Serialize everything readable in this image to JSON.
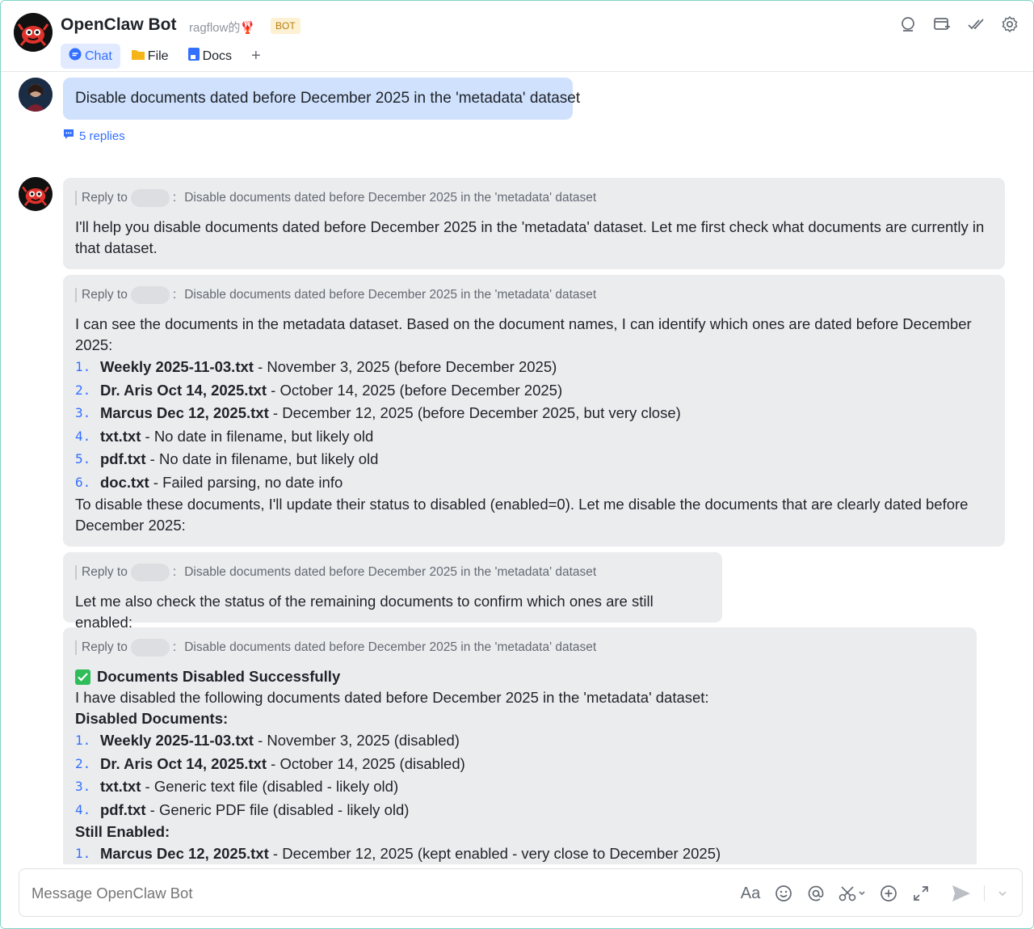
{
  "header": {
    "title": "OpenClaw Bot",
    "subtitle": "ragflow的🦞",
    "badge": "BOT",
    "tabs": [
      {
        "label": "Chat",
        "icon": "chat-bubble-icon"
      },
      {
        "label": "File",
        "icon": "folder-icon"
      },
      {
        "label": "Docs",
        "icon": "docs-icon"
      }
    ],
    "add_tab": "+"
  },
  "thread": {
    "user_message": "Disable documents dated before December 2025 in the 'metadata' dataset",
    "replies_label": "5 replies"
  },
  "reply_ref": {
    "prefix": "Reply to",
    "quoted": "Disable documents dated before December 2025 in the 'metadata' dataset"
  },
  "messages": {
    "m1": {
      "text": "I'll help you disable documents dated before December 2025 in the 'metadata' dataset. Let me first check what documents are currently in that dataset."
    },
    "m2": {
      "intro": "I can see the documents in the metadata dataset. Based on the document names, I can identify which ones are dated before December 2025:",
      "items": [
        {
          "num": "1.",
          "name": "Weekly 2025-11-03.txt",
          "desc": " - November 3, 2025 (before December 2025)"
        },
        {
          "num": "2.",
          "name": "Dr. Aris Oct 14, 2025.txt",
          "desc": " - October 14, 2025 (before December 2025)"
        },
        {
          "num": "3.",
          "name": "Marcus Dec 12, 2025.txt",
          "desc": " - December 12, 2025 (before December 2025, but very close)"
        },
        {
          "num": "4.",
          "name": "txt.txt",
          "desc": " - No date in filename, but likely old"
        },
        {
          "num": "5.",
          "name": "pdf.txt",
          "desc": " - No date in filename, but likely old"
        },
        {
          "num": "6.",
          "name": "doc.txt",
          "desc": " - Failed parsing, no date info"
        }
      ],
      "outro": "To disable these documents, I'll update their status to disabled (enabled=0). Let me disable the documents that are clearly dated before December 2025:"
    },
    "m3": {
      "text": "Let me also check the status of the remaining documents to confirm which ones are still enabled:"
    },
    "m4": {
      "heading": "Documents Disabled Successfully",
      "intro": "I have disabled the following documents dated before December 2025 in the 'metadata' dataset:",
      "disabled_title": "Disabled Documents:",
      "disabled": [
        {
          "num": "1.",
          "name": "Weekly 2025-11-03.txt",
          "desc": " - November 3, 2025 (disabled)"
        },
        {
          "num": "2.",
          "name": "Dr. Aris Oct 14, 2025.txt",
          "desc": " - October 14, 2025 (disabled)"
        },
        {
          "num": "3.",
          "name": "txt.txt",
          "desc": " - Generic text file (disabled - likely old)"
        },
        {
          "num": "4.",
          "name": "pdf.txt",
          "desc": " - Generic PDF file (disabled - likely old)"
        }
      ],
      "enabled_title": "Still Enabled:",
      "enabled": [
        {
          "num": "1.",
          "name": "Marcus Dec 12, 2025.txt",
          "desc": " - December 12, 2025 (kept enabled - very close to December 2025)"
        }
      ]
    }
  },
  "composer": {
    "placeholder": "Message OpenClaw Bot",
    "format_label": "Aa"
  },
  "colors": {
    "accent": "#3370ff",
    "user_bubble": "#cfe1fd",
    "bot_bubble": "#ebecee",
    "success": "#2ebd59",
    "badge_bg": "#fdf1d3"
  }
}
